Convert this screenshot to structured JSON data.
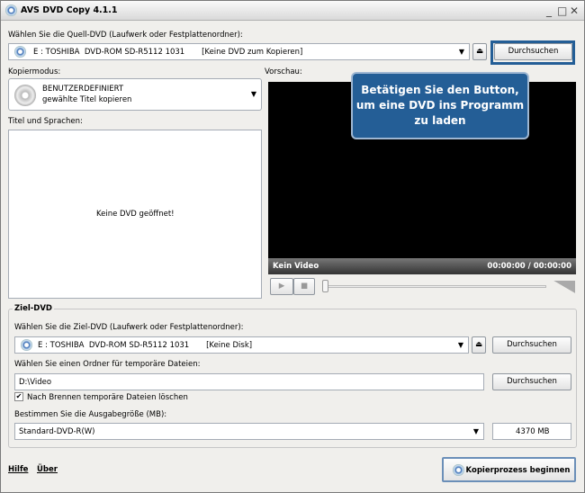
{
  "window": {
    "title": "AVS DVD Copy 4.1.1"
  },
  "source": {
    "label": "Wählen Sie die Quell-DVD (Laufwerk oder Festplattenordner):",
    "drive": "E : TOSHIBA  DVD-ROM SD-R5112 1031       [Keine DVD zum Kopieren]",
    "browse": "Durchsuchen"
  },
  "copymode": {
    "label": "Kopiermodus:",
    "title": "BENUTZERDEFINIERT",
    "subtitle": "gewählte Titel kopieren"
  },
  "titles": {
    "label": "Titel und Sprachen:",
    "empty": "Keine DVD geöffnet!"
  },
  "preview": {
    "label": "Vorschau:",
    "status": "Kein Video",
    "time": "00:00:00 / 00:00:00"
  },
  "tooltip": {
    "text": "Betätigen Sie den Button, um eine DVD ins Programm zu laden"
  },
  "target": {
    "group": "Ziel-DVD",
    "label": "Wählen Sie die Ziel-DVD (Laufwerk oder Festplattenordner):",
    "drive": "E : TOSHIBA  DVD-ROM SD-R5112 1031       [Keine Disk]",
    "browse": "Durchsuchen",
    "temp_label": "Wählen Sie einen Ordner für temporäre Dateien:",
    "temp_value": "D:\\Video",
    "temp_browse": "Durchsuchen",
    "delete_label": "Nach Brennen temporäre Dateien löschen",
    "delete_checked": true,
    "size_label": "Bestimmen Sie die Ausgabegröße (MB):",
    "size_value": "Standard-DVD-R(W)",
    "size_mb": "4370 MB"
  },
  "footer": {
    "help": "Hilfe",
    "about": "Über",
    "start": "Kopierprozess beginnen"
  }
}
